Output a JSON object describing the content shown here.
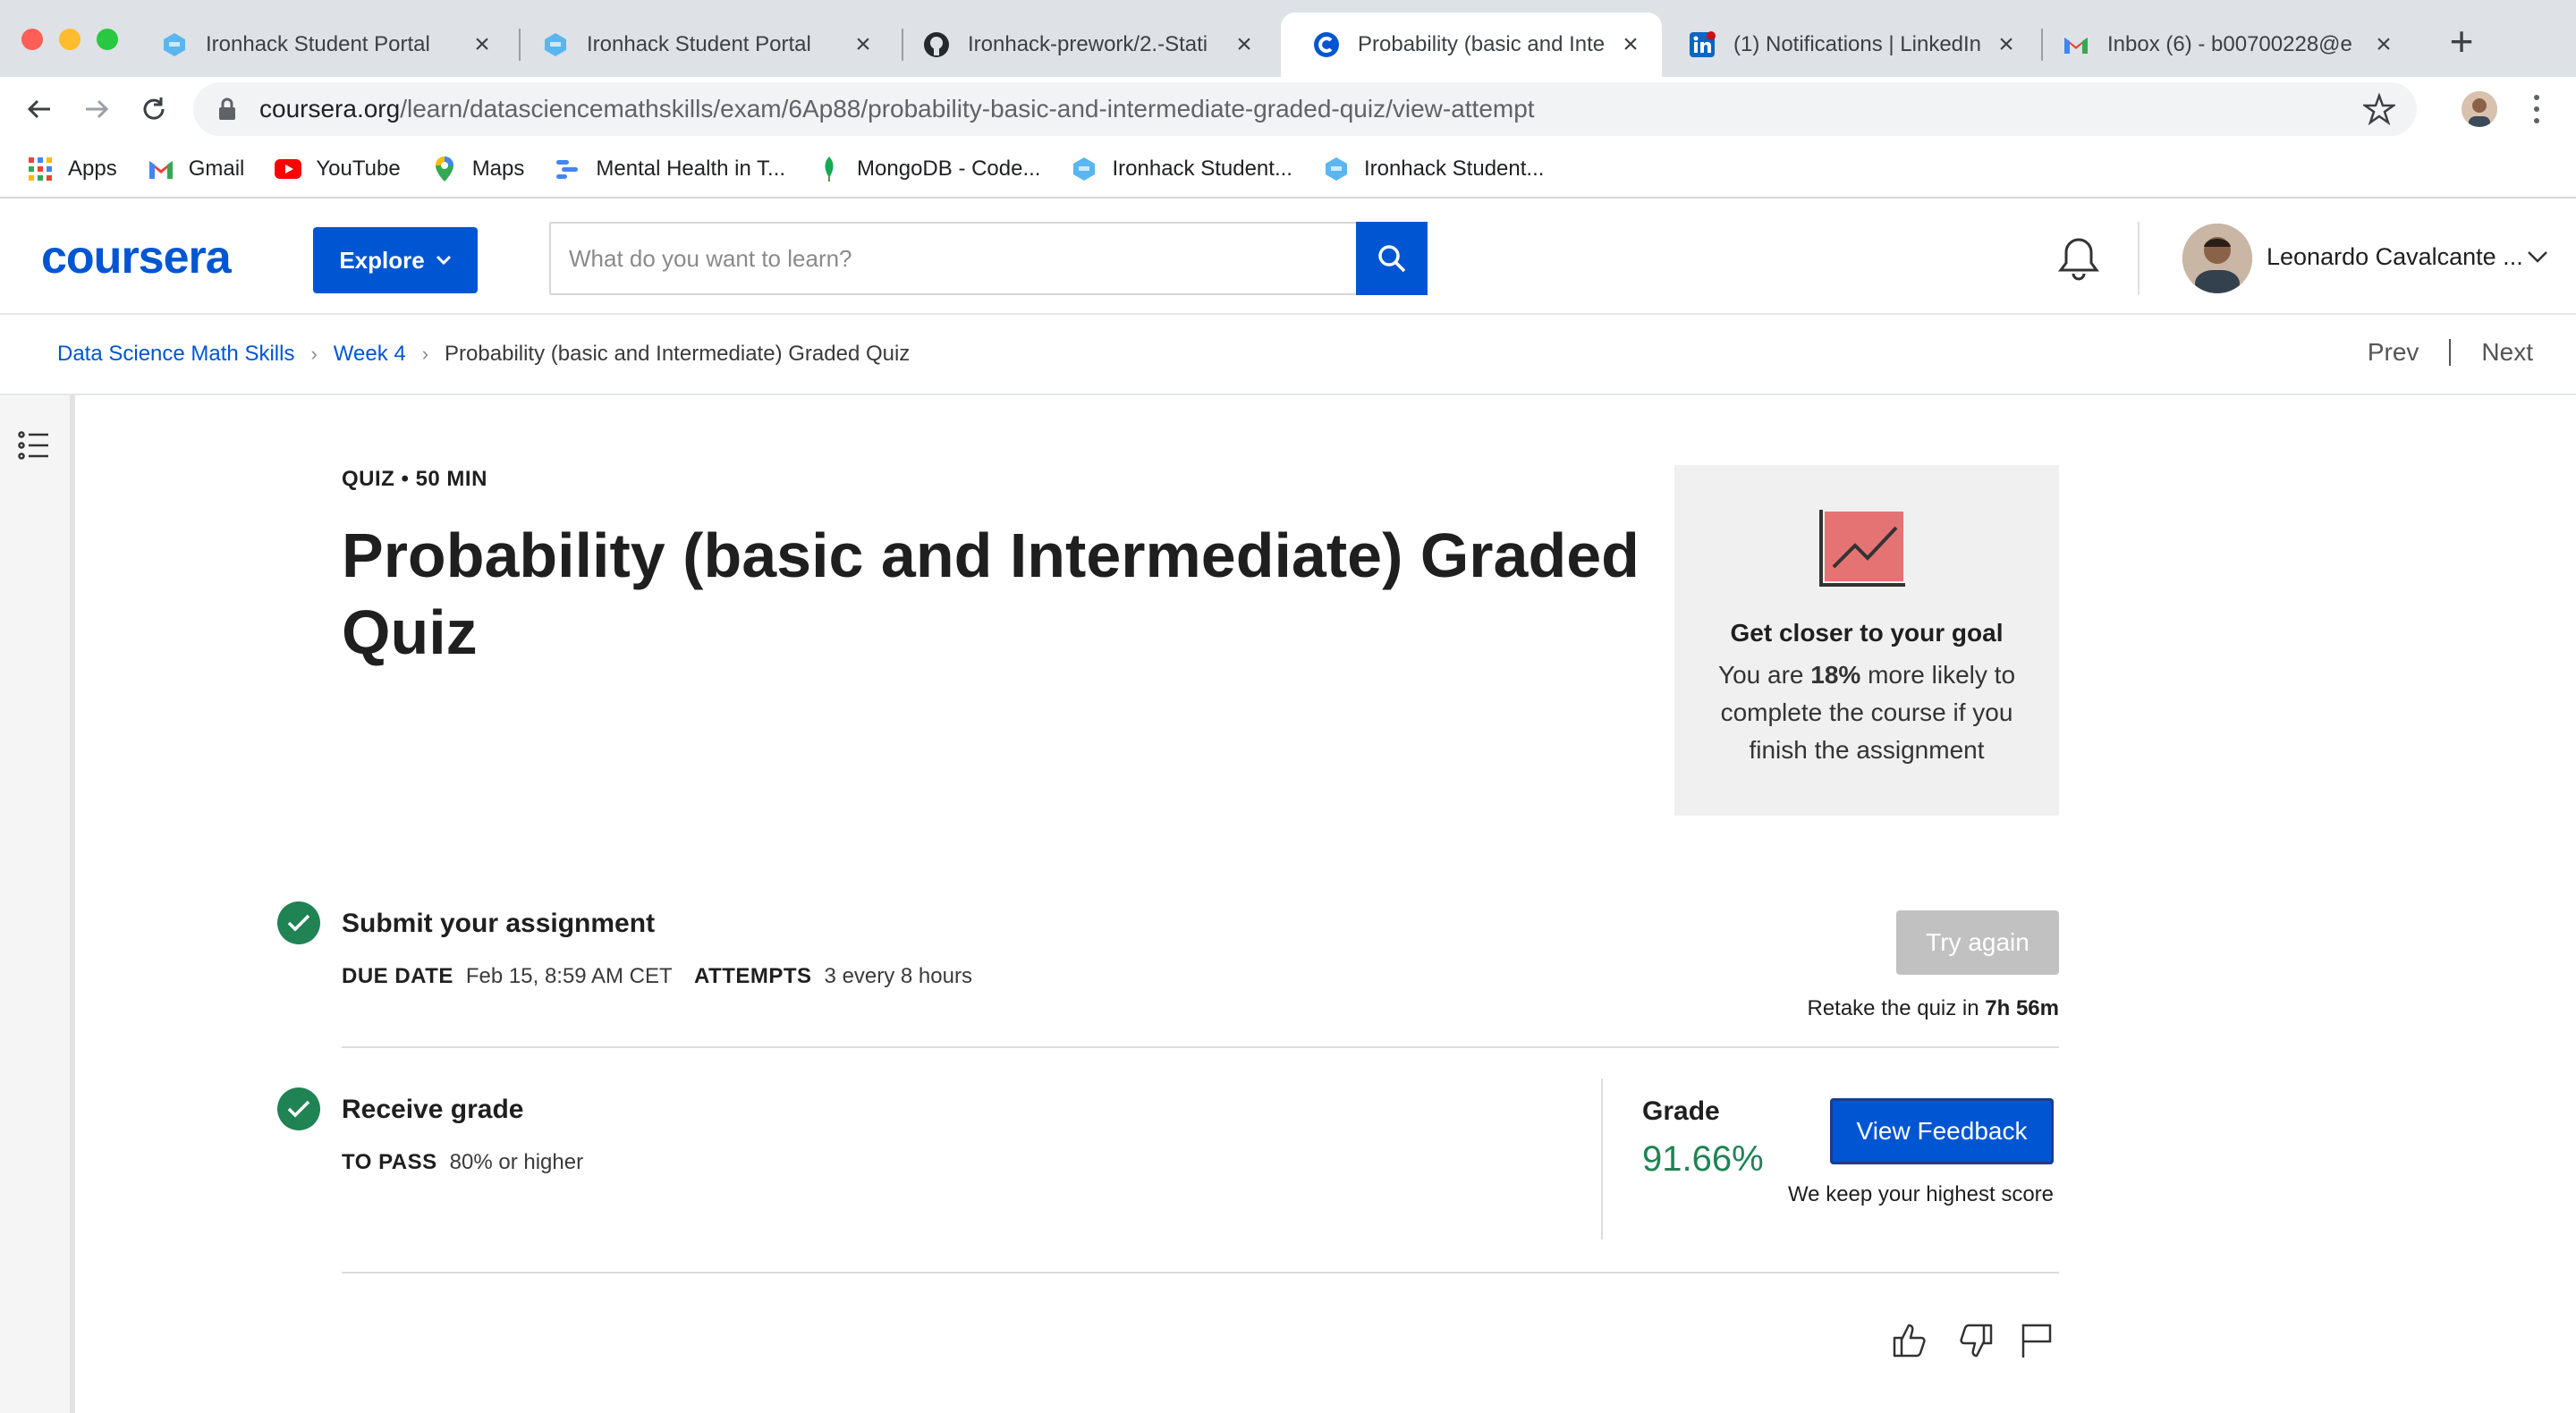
{
  "browser": {
    "tabs": [
      {
        "title": "Ironhack Student Portal",
        "icon": "ironhack-icon",
        "active": false
      },
      {
        "title": "Ironhack Student Portal",
        "icon": "ironhack-icon",
        "active": false
      },
      {
        "title": "Ironhack-prework/2.-Stati",
        "icon": "github-icon",
        "active": false
      },
      {
        "title": "Probability (basic and Inte",
        "icon": "coursera-icon",
        "active": true
      },
      {
        "title": "(1) Notifications | LinkedIn",
        "icon": "linkedin-icon",
        "active": false
      },
      {
        "title": "Inbox (6) - b00700228@e",
        "icon": "gmail-icon",
        "active": false
      }
    ],
    "url_host": "coursera.org",
    "url_path": "/learn/datasciencemathskills/exam/6Ap88/probability-basic-and-intermediate-graded-quiz/view-attempt",
    "bookmarks": [
      {
        "label": "Apps",
        "icon": "apps-grid-icon"
      },
      {
        "label": "Gmail",
        "icon": "gmail-icon"
      },
      {
        "label": "YouTube",
        "icon": "youtube-icon"
      },
      {
        "label": "Maps",
        "icon": "maps-pin-icon"
      },
      {
        "label": "Mental Health in T...",
        "icon": "mental-health-icon"
      },
      {
        "label": "MongoDB - Code...",
        "icon": "mongodb-leaf-icon"
      },
      {
        "label": "Ironhack Student...",
        "icon": "ironhack-icon"
      },
      {
        "label": "Ironhack Student...",
        "icon": "ironhack-icon"
      }
    ]
  },
  "header": {
    "logo": "coursera",
    "explore_label": "Explore",
    "search_placeholder": "What do you want to learn?",
    "user_name": "Leonardo Cavalcante ..."
  },
  "breadcrumb": {
    "course": "Data Science Math Skills",
    "week": "Week 4",
    "current": "Probability (basic and Intermediate) Graded Quiz",
    "prev_label": "Prev",
    "next_label": "Next"
  },
  "quiz": {
    "meta": "QUIZ • 50 MIN",
    "title": "Probability (basic and Intermediate) Graded Quiz"
  },
  "goal_card": {
    "heading": "Get closer to your goal",
    "text_before": "You are ",
    "text_bold": "18%",
    "text_after": " more likely to complete the course if you finish the assignment"
  },
  "submit_section": {
    "title": "Submit your assignment",
    "due_label": "DUE DATE",
    "due_value": "Feb 15, 8:59 AM CET",
    "attempts_label": "ATTEMPTS",
    "attempts_value": "3 every 8 hours",
    "try_again_label": "Try again",
    "retake_prefix": "Retake the quiz in ",
    "retake_time": "7h 56m"
  },
  "grade_section": {
    "title": "Receive grade",
    "pass_label": "TO PASS",
    "pass_value": "80% or higher",
    "grade_label": "Grade",
    "grade_value": "91.66%",
    "feedback_label": "View Feedback",
    "note": "We keep your highest score"
  },
  "colors": {
    "brand_blue": "#0056d2",
    "success_green": "#1f8354",
    "disabled_gray": "#c1c1c1"
  }
}
